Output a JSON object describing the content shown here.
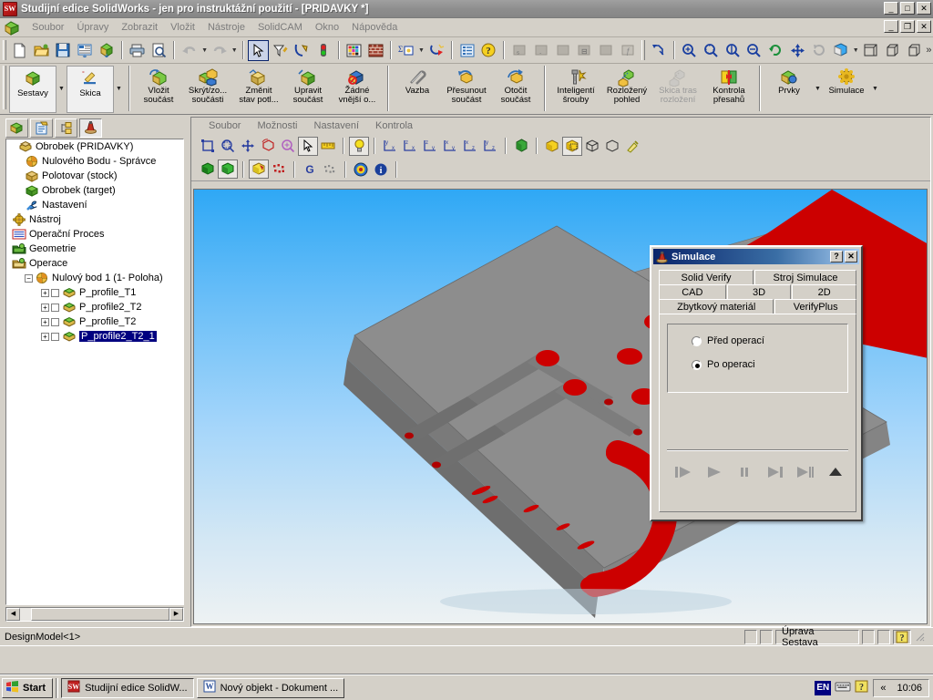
{
  "window": {
    "title": "Studijní edice SolidWorks - jen pro instruktážní použití - [PRIDAVKY *]",
    "min_label": "_",
    "max_label": "□",
    "close_label": "✕",
    "doc_min_label": "_",
    "doc_restore_label": "❐",
    "doc_close_label": "✕"
  },
  "menubar": {
    "items": [
      {
        "label": "Soubor"
      },
      {
        "label": "Úpravy"
      },
      {
        "label": "Zobrazit"
      },
      {
        "label": "Vložit"
      },
      {
        "label": "Nástroje"
      },
      {
        "label": "SolidCAM"
      },
      {
        "label": "Okno"
      },
      {
        "label": "Nápověda"
      }
    ]
  },
  "toolbar_standard": {
    "buttons": [
      {
        "icon": "new-document-icon"
      },
      {
        "icon": "open-folder-icon"
      },
      {
        "icon": "save-icon"
      },
      {
        "icon": "print-layout-icon"
      },
      {
        "icon": "rebuild-model-icon"
      },
      {
        "icon": "print-icon"
      },
      {
        "icon": "print-preview-icon"
      },
      {
        "icon": "undo-icon"
      },
      {
        "icon": "redo-icon"
      },
      {
        "icon": "select-arrow-icon"
      },
      {
        "icon": "filter-icon"
      },
      {
        "icon": "measure-sketch-icon"
      },
      {
        "icon": "traffic-light-icon"
      },
      {
        "icon": "color-palette-icon"
      },
      {
        "icon": "material-brick-icon"
      },
      {
        "icon": "mass-properties-icon"
      },
      {
        "icon": "rebuild-refresh-icon"
      },
      {
        "icon": "options-list-icon"
      },
      {
        "icon": "help-icon"
      }
    ]
  },
  "toolbar_view": {
    "buttons": [
      {
        "icon": "section-view-icon"
      },
      {
        "icon": "zoom-to-fit-icon"
      },
      {
        "icon": "zoom-to-area-icon"
      },
      {
        "icon": "zoom-in-out-icon"
      },
      {
        "icon": "rotate-view-icon"
      },
      {
        "icon": "pan-icon"
      },
      {
        "icon": "previous-view-icon"
      },
      {
        "icon": "display-style-icon"
      },
      {
        "icon": "isometric-view-icon"
      },
      {
        "icon": "trimetric-view-icon"
      },
      {
        "icon": "dimetric-view-icon"
      },
      {
        "icon": "more-icon"
      }
    ]
  },
  "toolbar_assembly": {
    "buttons": [
      {
        "label": "Sestavy",
        "icon": "assembly-icon",
        "framed": true,
        "dropdown": true,
        "dim": false
      },
      {
        "label": "Skica",
        "icon": "sketch-icon",
        "framed": true,
        "dropdown": true,
        "dim": false
      },
      {
        "label": "Vložit\nsoučást",
        "line1": "Vložit",
        "line2": "součást",
        "icon": "insert-component-icon",
        "dim": false
      },
      {
        "label": "Skrýt/zo...\nsoučásti",
        "line1": "Skrýt/zo...",
        "line2": "součásti",
        "icon": "hide-show-icon",
        "dim": false
      },
      {
        "label": "Změnit\nstav potl...",
        "line1": "Změnit",
        "line2": "stav potl...",
        "icon": "change-state-icon",
        "dim": false
      },
      {
        "label": "Upravit\nsoučást",
        "line1": "Upravit",
        "line2": "součást",
        "icon": "edit-component-icon",
        "dim": false
      },
      {
        "label": "Žádné\nvnější o...",
        "line1": "Žádné",
        "line2": "vnější o...",
        "icon": "no-external-refs-icon",
        "dim": false
      },
      {
        "label": "Vazba",
        "line1": "Vazba",
        "line2": "",
        "icon": "mate-icon",
        "dim": false
      },
      {
        "label": "Přesunout\nsoučást",
        "line1": "Přesunout",
        "line2": "součást",
        "icon": "move-component-icon",
        "dim": false
      },
      {
        "label": "Otočit\nsoučást",
        "line1": "Otočit",
        "line2": "součást",
        "icon": "rotate-component-icon",
        "dim": false
      },
      {
        "label": "Inteligentí\nšrouby",
        "line1": "Inteligentí",
        "line2": "šrouby",
        "icon": "smart-fasteners-icon",
        "dim": false
      },
      {
        "label": "Rozložený\npohled",
        "line1": "Rozložený",
        "line2": "pohled",
        "icon": "exploded-view-icon",
        "dim": false
      },
      {
        "label": "Skica tras\nrozložení",
        "line1": "Skica tras",
        "line2": "rozložení",
        "icon": "explode-sketch-icon",
        "dim": true
      },
      {
        "label": "Kontrola\npřesahů",
        "line1": "Kontrola",
        "line2": "přesahů",
        "icon": "interference-check-icon",
        "dim": false
      },
      {
        "label": "Prvky",
        "line1": "Prvky",
        "line2": "",
        "icon": "features-icon",
        "dropdown": true,
        "dim": false
      },
      {
        "label": "Simulace",
        "line1": "Simulace",
        "line2": "",
        "icon": "simulation-gear-icon",
        "dropdown": true,
        "dim": false
      }
    ]
  },
  "feature_manager": {
    "tabs": [
      {
        "name": "feature-tree-tab",
        "active": false
      },
      {
        "name": "property-manager-tab",
        "active": false
      },
      {
        "name": "configuration-manager-tab",
        "active": false
      },
      {
        "name": "solidcam-manager-tab",
        "active": true
      }
    ],
    "tree": [
      {
        "label": "Obrobek (PRIDAVKY)",
        "indent": 0,
        "icon": "workpiece-icon",
        "expander": "dot",
        "selected": false
      },
      {
        "label": "Nulového Bodu - Správce",
        "indent": 1,
        "icon": "coordinate-system-icon",
        "selected": false
      },
      {
        "label": "Polotovar (stock)",
        "indent": 1,
        "icon": "stock-box-icon",
        "selected": false
      },
      {
        "label": "Obrobek (target)",
        "indent": 1,
        "icon": "target-green-icon",
        "selected": false
      },
      {
        "label": "Nastavení",
        "indent": 1,
        "icon": "wrench-icon",
        "selected": false
      },
      {
        "label": "Nástroj",
        "indent": 0,
        "icon": "tool-gear-icon",
        "selected": false
      },
      {
        "label": "Operační Proces",
        "indent": 0,
        "icon": "process-list-icon",
        "selected": false
      },
      {
        "label": "Geometrie",
        "indent": 0,
        "icon": "geometry-folder-icon",
        "expander": "plus",
        "selected": false
      },
      {
        "label": "Operace",
        "indent": 0,
        "icon": "operations-folder-icon",
        "expander": "plus",
        "selected": false
      },
      {
        "label": "Nulový bod 1 (1- Poloha)",
        "indent": 1,
        "icon": "coordinate-system-icon",
        "expander": "minus",
        "selected": false
      },
      {
        "label": "P_profile_T1",
        "indent": 2,
        "icon": "operation-icon",
        "expander": "plus",
        "checkbox": true,
        "selected": false
      },
      {
        "label": "P_profile2_T2",
        "indent": 2,
        "icon": "operation-icon",
        "expander": "plus",
        "checkbox": true,
        "selected": false
      },
      {
        "label": "P_profile_T2",
        "indent": 2,
        "icon": "operation-icon",
        "expander": "plus",
        "checkbox": true,
        "selected": false
      },
      {
        "label": "P_profile2_T2_1",
        "indent": 2,
        "icon": "operation-icon",
        "expander": "plus",
        "checkbox": true,
        "selected": true
      }
    ],
    "scroll_left": "◀",
    "scroll_right": "▶"
  },
  "view_window": {
    "menu": [
      {
        "label": "Soubor"
      },
      {
        "label": "Možnosti"
      },
      {
        "label": "Nastavení"
      },
      {
        "label": "Kontrola"
      }
    ],
    "toolbar_row1": [
      {
        "icon": "fit-frame-icon"
      },
      {
        "icon": "zoom-window-icon"
      },
      {
        "icon": "pan-move-icon"
      },
      {
        "icon": "rotate-box-icon"
      },
      {
        "icon": "zoom-magnifier-icon"
      },
      {
        "icon": "select-arrow-icon",
        "selected": true
      },
      {
        "icon": "measure-ruler-icon"
      },
      {
        "icon": "light-bulb-icon",
        "selected": true
      },
      {
        "icon": "view-yx-icon"
      },
      {
        "icon": "view-zx-icon"
      },
      {
        "icon": "view-zy-icon"
      },
      {
        "icon": "view-xy-icon"
      },
      {
        "icon": "view-xz-icon"
      },
      {
        "icon": "view-yz-icon"
      },
      {
        "icon": "globe-isometric-icon"
      },
      {
        "icon": "shade-yellow-icon"
      },
      {
        "icon": "shade-selected-icon",
        "selected": true
      },
      {
        "icon": "wireframe-icon"
      },
      {
        "icon": "box-outline-icon"
      },
      {
        "icon": "paint-brush-icon"
      }
    ],
    "toolbar_row2": [
      {
        "icon": "solid-green-cube-icon"
      },
      {
        "icon": "solid-green-cube2-icon",
        "selected": true
      },
      {
        "icon": "stock-render-icon",
        "selected": true
      },
      {
        "icon": "points-cloud-red-icon"
      },
      {
        "icon": "g-code-icon",
        "label": "G"
      },
      {
        "icon": "points-grid-icon"
      },
      {
        "icon": "target-circle-icon"
      },
      {
        "icon": "info-icon"
      }
    ]
  },
  "simulace_dialog": {
    "title": "Simulace",
    "help_label": "?",
    "close_label": "✕",
    "tabs_row1": [
      {
        "label": "Solid Verify",
        "active": false
      },
      {
        "label": "Stroj Simulace",
        "active": false
      }
    ],
    "tabs_row2": [
      {
        "label": "CAD",
        "active": false
      },
      {
        "label": "3D",
        "active": false
      },
      {
        "label": "2D",
        "active": false
      }
    ],
    "tabs_row3": [
      {
        "label": "Zbytkový materiál",
        "active": true
      },
      {
        "label": "VerifyPlus",
        "active": false
      }
    ],
    "radios": [
      {
        "label": "Před operací",
        "selected": false
      },
      {
        "label": "Po operaci",
        "selected": true
      }
    ],
    "transport": [
      {
        "name": "step-play-button",
        "glyph": "step-play-icon",
        "dim": true
      },
      {
        "name": "play-button",
        "glyph": "play-icon",
        "dim": true
      },
      {
        "name": "pause-button",
        "glyph": "pause-icon",
        "dim": true
      },
      {
        "name": "next-operation-button",
        "glyph": "skip-next-icon",
        "dim": true
      },
      {
        "name": "end-button",
        "glyph": "play-to-end-icon",
        "dim": true
      },
      {
        "name": "eject-button",
        "glyph": "eject-icon",
        "dim": false
      }
    ]
  },
  "statusbar": {
    "left_text": "DesignModel<1>",
    "mode_text": "Úprava Sestava",
    "help_glyph": "?"
  },
  "taskbar": {
    "start_label": "Start",
    "items": [
      {
        "label": "Studijní edice SolidW...",
        "icon": "solidworks-icon",
        "active": true
      },
      {
        "label": "Nový objekt - Dokument ...",
        "icon": "word-icon",
        "active": false
      }
    ],
    "tray": {
      "language": "EN",
      "keyboard_icon": "keyboard-icon",
      "help_icon": "help-tray-icon",
      "expand_label": "«",
      "clock": "10:06"
    }
  },
  "colors": {
    "titlebar_inactive": "#8e8e8e",
    "dialog_titlebar": "#0a246a",
    "selection_blue": "#000080",
    "face_gray": "#d4d0c8",
    "model_red": "#cc0000",
    "model_gray": "#8c8c8c",
    "sky_top": "#2fa8f5",
    "sky_bottom": "#eef2f3"
  }
}
